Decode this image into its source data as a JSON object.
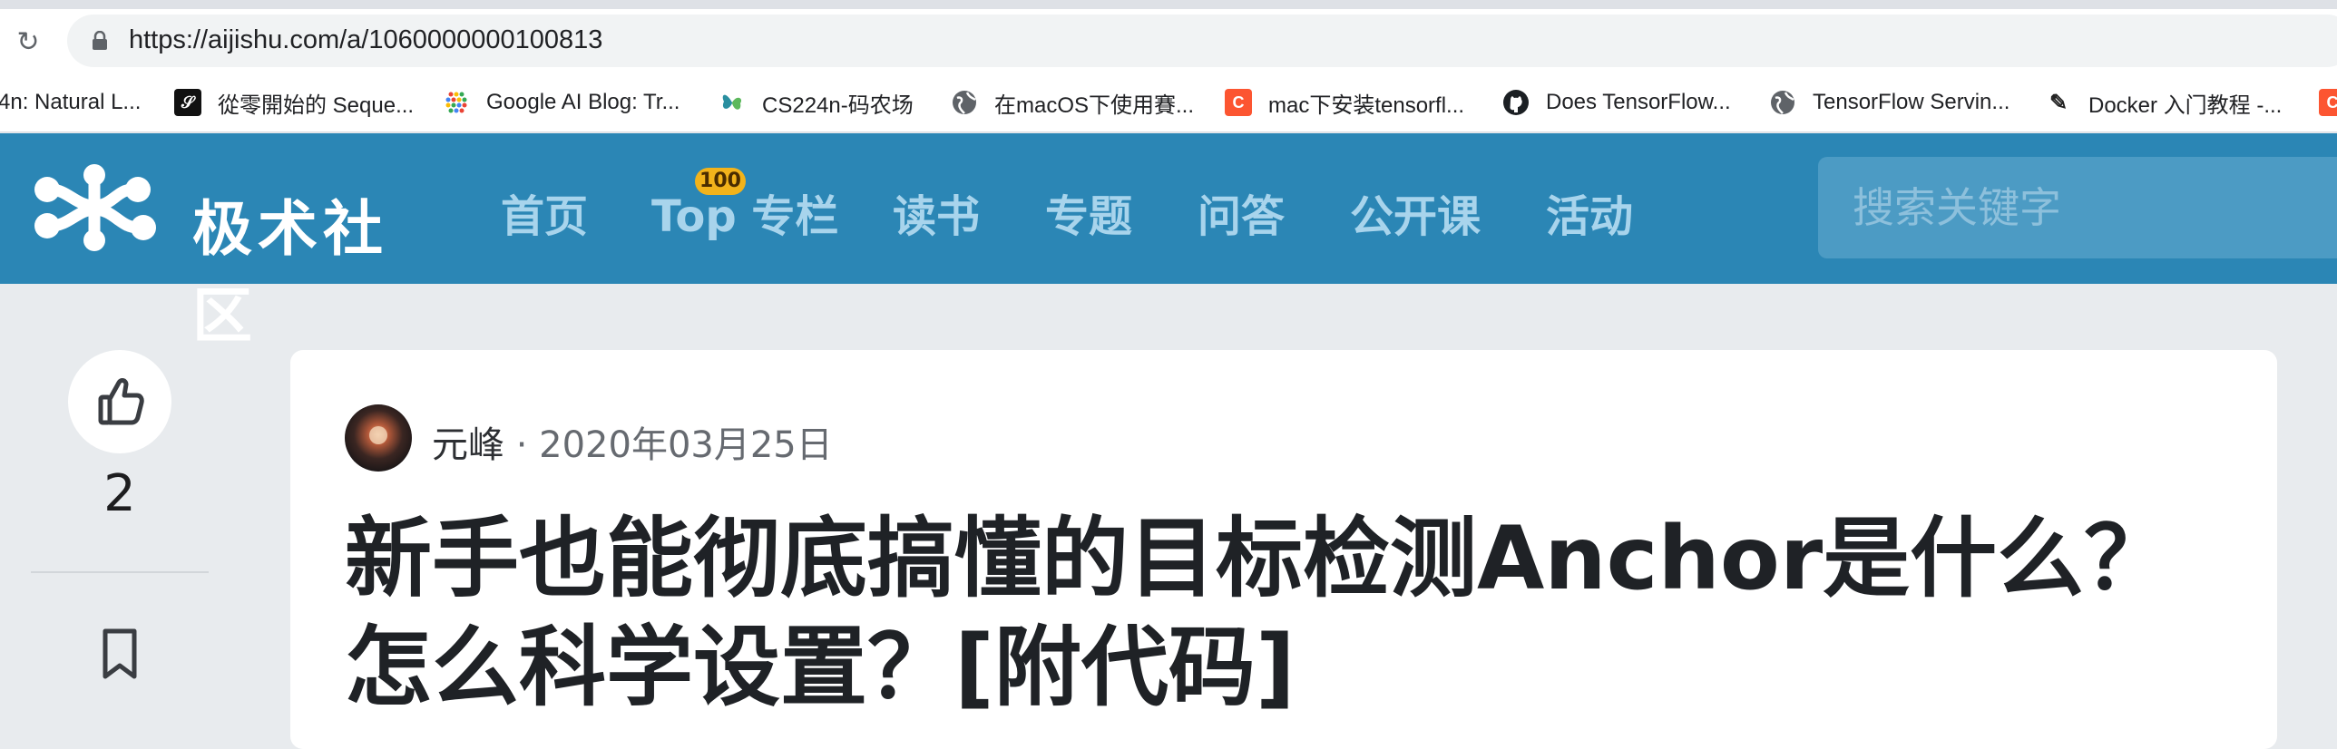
{
  "browser": {
    "url": "https://aijishu.com/a/1060000000100813",
    "bookmarks": [
      {
        "label": "4n: Natural L...",
        "icon": "none"
      },
      {
        "label": "從零開始的 Seque...",
        "icon": "seq-icon"
      },
      {
        "label": "Google AI Blog: Tr...",
        "icon": "google-ai-icon"
      },
      {
        "label": "CS224n-码农场",
        "icon": "butterfly-icon"
      },
      {
        "label": "在macOS下使用賽...",
        "icon": "globe-icon"
      },
      {
        "label": "mac下安装tensorfl...",
        "icon": "csdn-icon"
      },
      {
        "label": "Does TensorFlow...",
        "icon": "github-icon"
      },
      {
        "label": "TensorFlow Servin...",
        "icon": "globe-icon"
      },
      {
        "label": "Docker 入门教程 -...",
        "icon": "ruanyifeng-icon"
      }
    ]
  },
  "site": {
    "logo_text": "极术社区",
    "nav": [
      "首页",
      "Top 专栏",
      "读书",
      "专题",
      "问答",
      "公开课",
      "活动"
    ],
    "top_badge": "100",
    "search_placeholder": "搜索关键字",
    "colors": {
      "header": "#2b86b5",
      "nav_text": "#a8d4ec",
      "badge": "#f2b31b"
    }
  },
  "rail": {
    "like_count": "2"
  },
  "article": {
    "author": "元峰",
    "separator": " · ",
    "date": "2020年03月25日",
    "title": "新手也能彻底搞懂的目标检测Anchor是什么？怎么科学设置？[附代码]"
  }
}
